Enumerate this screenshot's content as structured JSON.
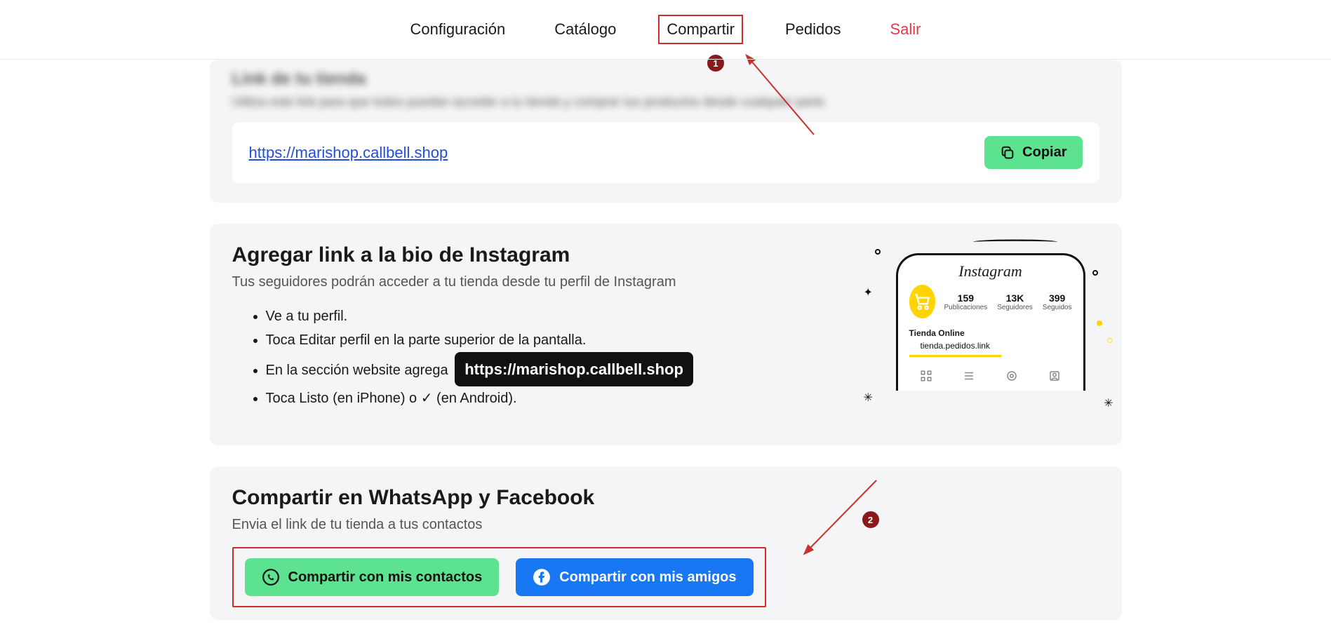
{
  "nav": {
    "config": "Configuración",
    "catalog": "Catálogo",
    "share": "Compartir",
    "orders": "Pedidos",
    "exit": "Salir"
  },
  "link_section": {
    "blur_title": "Link de tu tienda",
    "blur_sub": "Utiliza este link para que todos puedan acceder a tu tienda y comprar tus productos desde cualquier parte",
    "url": "https://marishop.callbell.shop",
    "copy_label": "Copiar"
  },
  "instagram": {
    "title": "Agregar link a la bio de Instagram",
    "subtitle": "Tus seguidores podrán acceder a tu tienda desde tu perfil de Instagram",
    "steps": {
      "s1": "Ve a tu perfil.",
      "s2": "Toca Editar perfil en la parte superior de la pantalla.",
      "s3_prefix": "En la sección website agrega",
      "s3_url": "https://marishop.callbell.shop",
      "s4": "Toca Listo (en iPhone) o ✓ (en Android)."
    },
    "phone": {
      "logo": "Instagram",
      "posts": "159",
      "posts_label": "Publicaciones",
      "followers": "13K",
      "followers_label": "Seguidores",
      "following": "399",
      "following_label": "Seguidos",
      "name": "Tienda Online",
      "url": "tienda.pedidos.link"
    }
  },
  "share": {
    "title": "Compartir en WhatsApp y Facebook",
    "subtitle": "Envia el link de tu tienda a tus contactos",
    "whatsapp_label": "Compartir con mis contactos",
    "facebook_label": "Compartir con mis amigos"
  },
  "annotations": {
    "badge1": "1",
    "badge2": "2"
  }
}
